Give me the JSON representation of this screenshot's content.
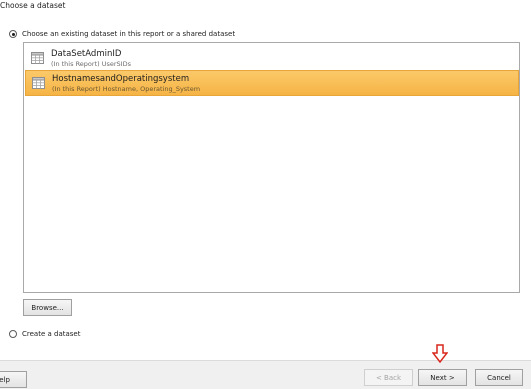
{
  "heading": "Choose a dataset",
  "option_existing": {
    "label": "Choose an existing dataset in this report or a shared dataset",
    "selected": true
  },
  "datasets": [
    {
      "name": "DataSetAdminID",
      "subtitle": "(In this Report) UserSIDs",
      "selected": false
    },
    {
      "name": "HostnamesandOperatingsystem",
      "subtitle": "(In this Report) Hostname, Operating_System",
      "selected": true
    }
  ],
  "browse_label": "Browse...",
  "option_create": {
    "label": "Create a dataset",
    "selected": false
  },
  "footer": {
    "help_label": "Help",
    "back_label": "< Back",
    "next_label": "Next >",
    "cancel_label": "Cancel"
  },
  "colors": {
    "selection": "#f6b445",
    "annotation_arrow": "#d9261c"
  },
  "icons": {
    "dataset": "table-icon",
    "annotation": "down-arrow-icon"
  }
}
